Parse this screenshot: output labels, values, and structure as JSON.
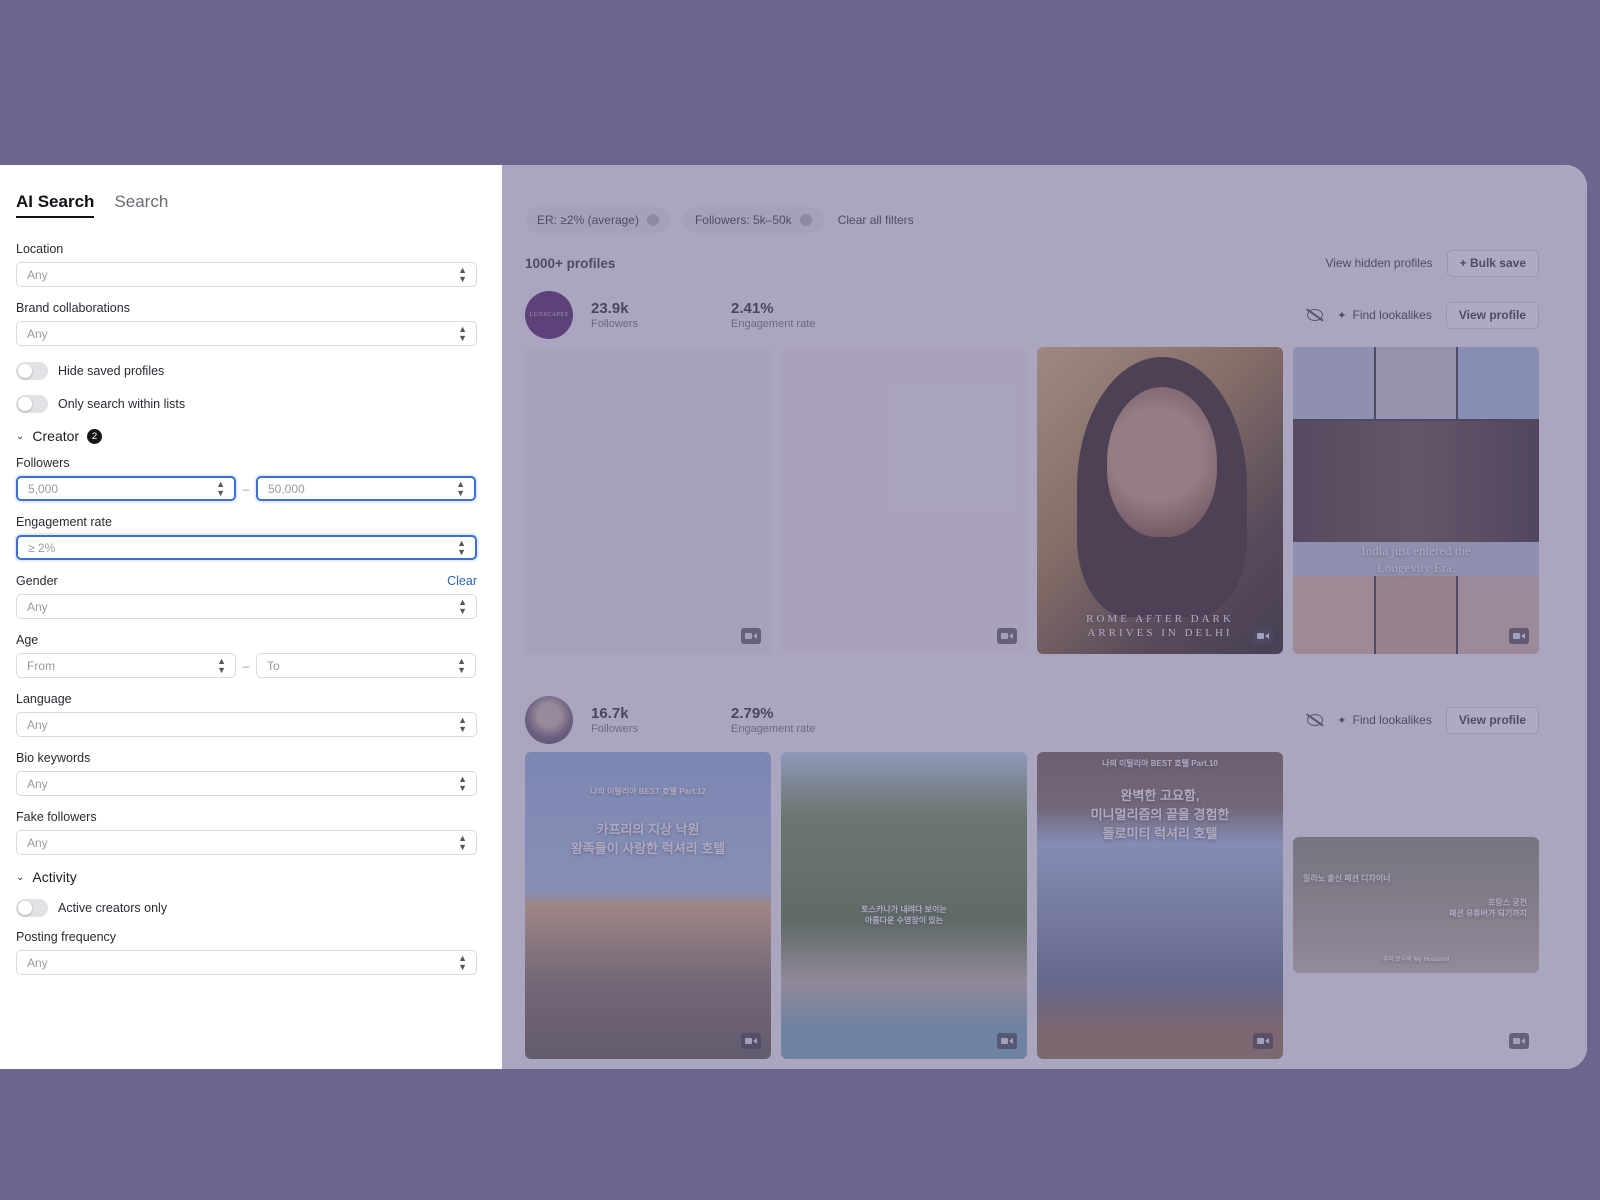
{
  "tabs": [
    {
      "label": "AI Search",
      "active": true
    },
    {
      "label": "Search",
      "active": false
    }
  ],
  "filters": {
    "location": {
      "label": "Location",
      "placeholder": "Any"
    },
    "brand": {
      "label": "Brand collaborations",
      "placeholder": "Any"
    },
    "hide_saved": {
      "label": "Hide saved profiles"
    },
    "only_lists": {
      "label": "Only search within lists"
    },
    "creator_section": {
      "label": "Creator",
      "count": "2"
    },
    "followers": {
      "label": "Followers",
      "min": "5,000",
      "max": "50,000",
      "dash": "–"
    },
    "engagement": {
      "label": "Engagement rate",
      "value": "≥ 2%"
    },
    "gender": {
      "label": "Gender",
      "clear": "Clear",
      "placeholder": "Any"
    },
    "age": {
      "label": "Age",
      "from": "From",
      "to": "To",
      "dash": "–"
    },
    "language": {
      "label": "Language",
      "placeholder": "Any"
    },
    "bio": {
      "label": "Bio keywords",
      "placeholder": "Any"
    },
    "fake": {
      "label": "Fake followers",
      "placeholder": "Any"
    },
    "activity_section": {
      "label": "Activity"
    },
    "active_only": {
      "label": "Active creators only"
    },
    "posting": {
      "label": "Posting frequency",
      "placeholder": "Any"
    }
  },
  "chips": [
    {
      "label": "ER: ≥2% (average)"
    },
    {
      "label": "Followers: 5k–50k"
    }
  ],
  "clear_all": "Clear all filters",
  "results": {
    "count": "1000+ profiles",
    "view_hidden": "View hidden profiles",
    "bulk_save": "+ Bulk save"
  },
  "profiles": [
    {
      "avatar_text": "LUXSCAPES",
      "followers": "23.9k",
      "followers_label": "Followers",
      "er": "2.41%",
      "er_label": "Engagement rate",
      "find_lookalikes": "Find lookalikes",
      "view_profile": "View profile",
      "posts": [
        {
          "caption": ""
        },
        {
          "caption": ""
        },
        {
          "caption": "ROME AFTER DARK\nARRIVES IN DELHI"
        },
        {
          "caption": "India just entered the\nLongevity Era."
        }
      ]
    },
    {
      "followers": "16.7k",
      "followers_label": "Followers",
      "er": "2.79%",
      "er_label": "Engagement rate",
      "find_lookalikes": "Find lookalikes",
      "view_profile": "View profile",
      "posts": [
        {
          "tag": "나의 이탈리아 BEST 호텔 Part.12",
          "caption": "카프리의 지상 낙원\n왕족들이 사랑한 럭셔리 호텔"
        },
        {
          "caption": "토스카나가 내려다 보이는\n아름다운 수영장이 있는"
        },
        {
          "tag": "나의 이탈리아 BEST 호텔 Part.10",
          "caption": "완벽한 고요함,\n미니멀리즘의 끝을 경험한\n돌로미티 럭셔리 호텔"
        },
        {
          "caption": "밀라노 출신 패션 디자이너",
          "caption2": "프랑스 궁전\n패션 유튜버가 되기까지",
          "caption3": "우리 모두의 My Husband"
        }
      ]
    }
  ],
  "colors": {
    "accent": "#3b6fd6",
    "overlay": "#6e658f"
  }
}
